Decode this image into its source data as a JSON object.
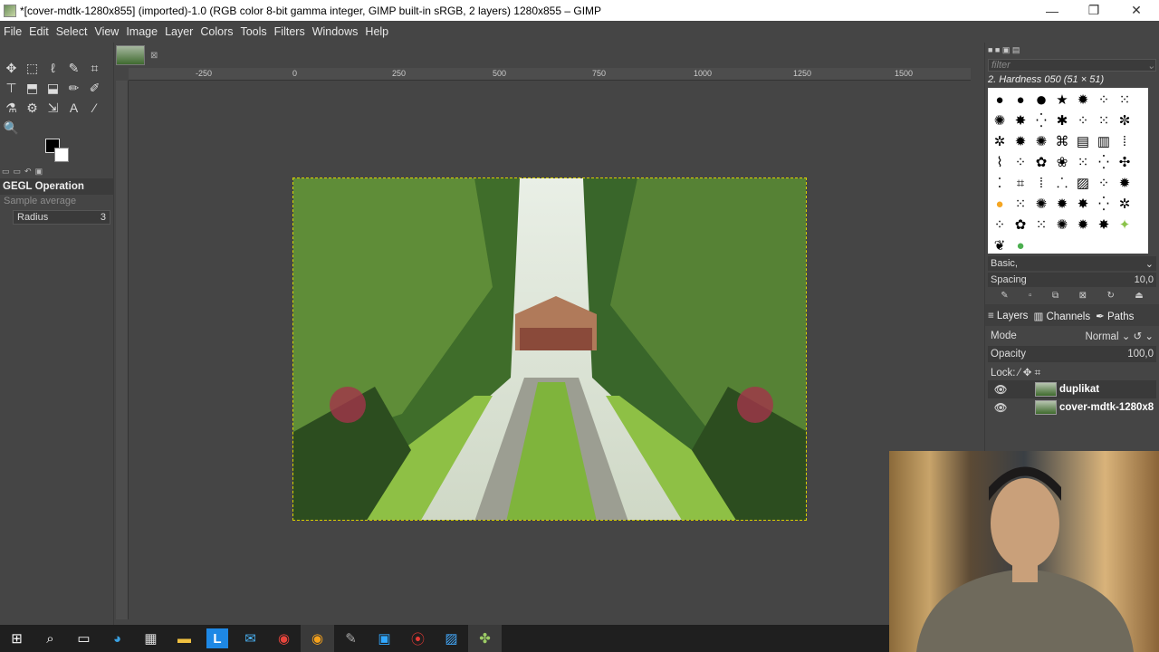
{
  "window": {
    "title": "*[cover-mdtk-1280x855] (imported)-1.0 (RGB color 8-bit gamma integer, GIMP built-in sRGB, 2 layers) 1280x855 – GIMP",
    "minimize": "—",
    "maximize": "❐",
    "close": "✕"
  },
  "menu": [
    "File",
    "Edit",
    "Select",
    "View",
    "Image",
    "Layer",
    "Colors",
    "Tools",
    "Filters",
    "Windows",
    "Help"
  ],
  "toolbox": {
    "tools": [
      "✥",
      "⬚",
      "ℓ",
      "✎",
      "⌗",
      "⊤",
      "⬒",
      "⬓",
      "✏",
      "✐",
      "⚗",
      "⚙",
      "⇲",
      "A",
      "⁄",
      "🔍"
    ],
    "gegl_title": "GEGL Operation",
    "gegl_sub": "Sample average",
    "radius_label": "Radius",
    "radius_value": "3"
  },
  "canvas": {
    "ruler_ticks": [
      "-250",
      "0",
      "250",
      "500",
      "750",
      "1000",
      "1250",
      "1500"
    ],
    "image_close": "⊠"
  },
  "brushes": {
    "filter_placeholder": "filter",
    "selected_brush": "2. Hardness 050 (51 × 51)",
    "preset": "Basic,",
    "spacing_label": "Spacing",
    "spacing_value": "10,0"
  },
  "layers": {
    "tabs": [
      "Layers",
      "Channels",
      "Paths"
    ],
    "mode_label": "Mode",
    "mode_value": "Normal",
    "opacity_label": "Opacity",
    "opacity_value": "100,0",
    "lock_label": "Lock:",
    "items": [
      {
        "name": "duplikat",
        "visible": true
      },
      {
        "name": "cover-mdtk-1280x8",
        "visible": true
      }
    ]
  },
  "taskbar": {
    "icons": [
      "windows-start-icon",
      "search-icon",
      "task-view-icon",
      "edge-icon",
      "store-icon",
      "file-explorer-icon",
      "l-app-icon",
      "mail-icon",
      "chrome-icon",
      "chrome-alt-icon",
      "paint-icon",
      "photoshop-icon",
      "record-icon",
      "photos-icon",
      "gimp-icon"
    ]
  }
}
